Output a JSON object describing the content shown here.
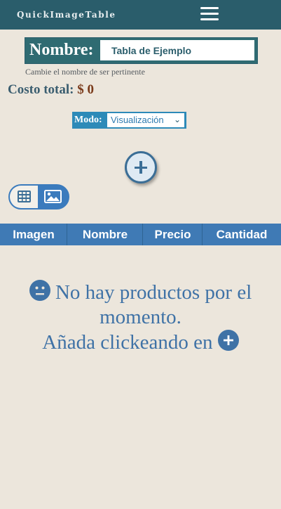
{
  "app": {
    "brand": "QuickImageTable"
  },
  "header": {
    "menu_icon": "hamburger-menu-icon"
  },
  "name_field": {
    "label": "Nombre:",
    "value": "Tabla de Ejemplo",
    "hint": "Cambie el nombre de ser pertinente"
  },
  "total": {
    "label": "Costo total:",
    "value": "$ 0"
  },
  "mode": {
    "label": "Modo:",
    "selected": "Visualización"
  },
  "view_toggle": {
    "left_icon": "grid-table-icon",
    "right_icon": "image-icon",
    "active": "grid"
  },
  "table": {
    "columns": [
      "Imagen",
      "Nombre",
      "Precio",
      "Cantidad"
    ]
  },
  "empty": {
    "line1": "No hay productos por el momento.",
    "line2": "Añada clickeando en"
  },
  "colors": {
    "topbar": "#2a5d6b",
    "accent": "#3f7ab5",
    "background": "#ece6dc",
    "total_value": "#7a3a1a"
  }
}
